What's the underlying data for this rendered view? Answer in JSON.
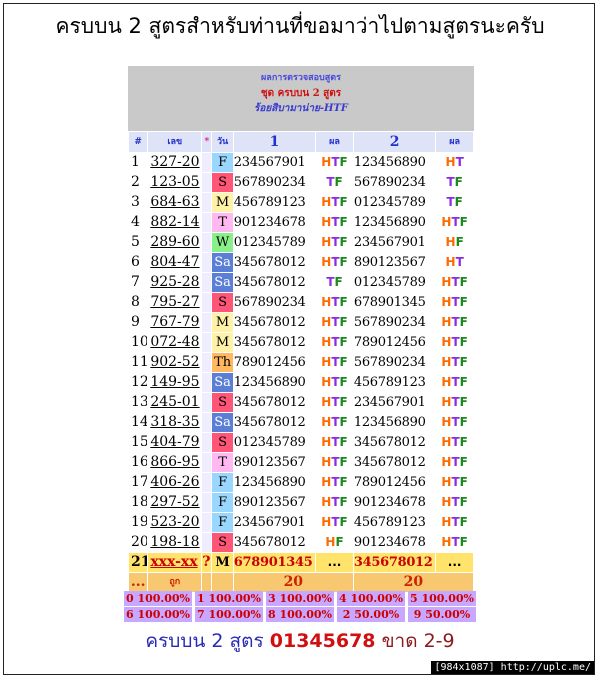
{
  "title": "ครบบน 2 สูตรสำหรับท่านที่ขอมาว่าไปตามสูตรนะครับ",
  "sheet": {
    "header_line1": "ผลการตรวจสอบสูตร",
    "header_line2": "ชุด ครบบน 2 สูตร",
    "header_line3": "ร้อยสิบามาน่าย-HTF",
    "columns": {
      "index": "#",
      "number": "เลข",
      "star": "*",
      "day": "วัน",
      "formula1": "1",
      "result1": "ผล",
      "formula2": "2",
      "result2": "ผล"
    },
    "rows": [
      {
        "n": "1",
        "code": "327-20",
        "day": "F",
        "f1": "234567901",
        "r1": "HTF",
        "f2": "123456890",
        "r2": "HT"
      },
      {
        "n": "2",
        "code": "123-05",
        "day": "S",
        "f1": "567890234",
        "r1": "TF",
        "f2": "567890234",
        "r2": "TF"
      },
      {
        "n": "3",
        "code": "684-63",
        "day": "M",
        "f1": "456789123",
        "r1": "HTF",
        "f2": "012345789",
        "r2": "TF"
      },
      {
        "n": "4",
        "code": "882-14",
        "day": "T",
        "f1": "901234678",
        "r1": "HTF",
        "f2": "123456890",
        "r2": "HTF"
      },
      {
        "n": "5",
        "code": "289-60",
        "day": "W",
        "f1": "012345789",
        "r1": "HTF",
        "f2": "234567901",
        "r2": "HF"
      },
      {
        "n": "6",
        "code": "804-47",
        "day": "Sa",
        "f1": "345678012",
        "r1": "HTF",
        "f2": "890123567",
        "r2": "HT"
      },
      {
        "n": "7",
        "code": "925-28",
        "day": "Sa",
        "f1": "345678012",
        "r1": "TF",
        "f2": "012345789",
        "r2": "HTF"
      },
      {
        "n": "8",
        "code": "795-27",
        "day": "S",
        "f1": "567890234",
        "r1": "HTF",
        "f2": "678901345",
        "r2": "HTF"
      },
      {
        "n": "9",
        "code": "767-79",
        "day": "M",
        "f1": "345678012",
        "r1": "HTF",
        "f2": "567890234",
        "r2": "HTF"
      },
      {
        "n": "10",
        "code": "072-48",
        "day": "M",
        "f1": "345678012",
        "r1": "HTF",
        "f2": "789012456",
        "r2": "HTF"
      },
      {
        "n": "11",
        "code": "902-52",
        "day": "Th",
        "f1": "789012456",
        "r1": "HTF",
        "f2": "567890234",
        "r2": "HTF"
      },
      {
        "n": "12",
        "code": "149-95",
        "day": "Sa",
        "f1": "123456890",
        "r1": "HTF",
        "f2": "456789123",
        "r2": "HTF"
      },
      {
        "n": "13",
        "code": "245-01",
        "day": "S",
        "f1": "345678012",
        "r1": "HTF",
        "f2": "234567901",
        "r2": "HTF"
      },
      {
        "n": "14",
        "code": "318-35",
        "day": "Sa",
        "f1": "345678012",
        "r1": "HTF",
        "f2": "123456890",
        "r2": "HTF"
      },
      {
        "n": "15",
        "code": "404-79",
        "day": "S",
        "f1": "012345789",
        "r1": "HTF",
        "f2": "345678012",
        "r2": "HTF"
      },
      {
        "n": "16",
        "code": "866-95",
        "day": "T",
        "f1": "890123567",
        "r1": "HTF",
        "f2": "345678012",
        "r2": "HTF"
      },
      {
        "n": "17",
        "code": "406-26",
        "day": "F",
        "f1": "123456890",
        "r1": "HTF",
        "f2": "789012456",
        "r2": "HTF"
      },
      {
        "n": "18",
        "code": "297-52",
        "day": "F",
        "f1": "890123567",
        "r1": "HTF",
        "f2": "901234678",
        "r2": "HTF"
      },
      {
        "n": "19",
        "code": "523-20",
        "day": "F",
        "f1": "234567901",
        "r1": "HTF",
        "f2": "456789123",
        "r2": "HTF"
      },
      {
        "n": "20",
        "code": "198-18",
        "day": "S",
        "f1": "345678012",
        "r1": "HF",
        "f2": "901234678",
        "r2": "HTF"
      }
    ],
    "last_row": {
      "n": "21",
      "code": "xxx-xx",
      "star": "?",
      "day": "M",
      "f1": "678901345",
      "r1": "...",
      "f2": "345678012",
      "r2": "..."
    },
    "totals": {
      "dots": "...",
      "label": "ถูก",
      "t1": "20",
      "t2": "20"
    }
  },
  "stats_row1": [
    "0  100.00%",
    "1  100.00%",
    "3  100.00%",
    "4  100.00%",
    "5  100.00%"
  ],
  "stats_row2": [
    "6  100.00%",
    "7  100.00%",
    "8  100.00%",
    "2  50.00%",
    "9  50.00%"
  ],
  "summary": {
    "part1": "ครบบน 2 สูตร",
    "part2": "01345678",
    "part3": "ขาด 2-9"
  },
  "watermark": "[984x1087] http://uplc.me/"
}
